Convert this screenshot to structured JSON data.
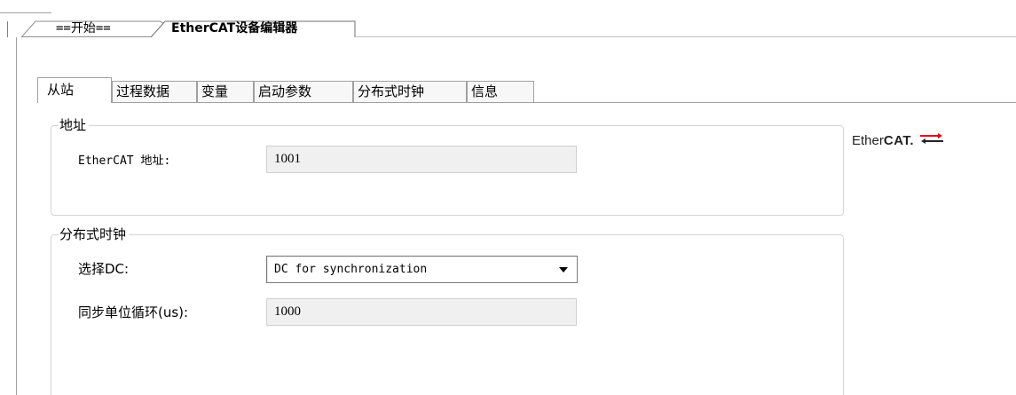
{
  "editor_tabs": [
    {
      "label": "==开始==",
      "active": false
    },
    {
      "label": "EtherCAT设备编辑器",
      "active": true
    }
  ],
  "inner_tabs": [
    {
      "label": "从站",
      "active": true
    },
    {
      "label": "过程数据",
      "active": false
    },
    {
      "label": "变量",
      "active": false
    },
    {
      "label": "启动参数",
      "active": false
    },
    {
      "label": "分布式时钟",
      "active": false
    },
    {
      "label": "信息",
      "active": false
    }
  ],
  "address_group": {
    "title": "地址",
    "ethercat_address_label": "EtherCAT 地址:",
    "ethercat_address_value": "1001"
  },
  "dc_group": {
    "title": "分布式时钟",
    "select_dc_label": "选择DC:",
    "select_dc_value": "DC for synchronization",
    "sync_cycle_label": "同步单位循环(us):",
    "sync_cycle_value": "1000"
  },
  "logo": {
    "text_regular": "Ether",
    "text_bold": "CAT.",
    "accent_color": "#e2001a"
  },
  "icons": [
    "dropdown-arrow-icon",
    "ethercat-logo-icon"
  ]
}
